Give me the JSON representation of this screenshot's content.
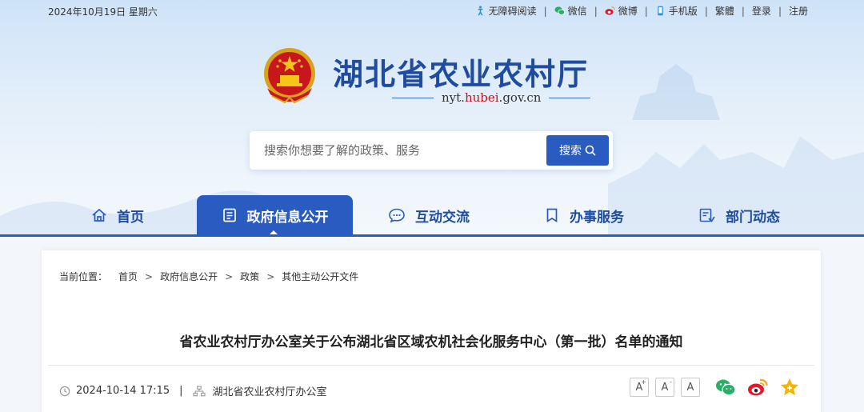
{
  "topbar": {
    "date": "2024年10月19日 星期六",
    "links": [
      {
        "label": "无障碍阅读",
        "icon": "accessibility-icon"
      },
      {
        "label": "微信",
        "icon": "wechat-icon"
      },
      {
        "label": "微博",
        "icon": "weibo-icon"
      },
      {
        "label": "手机版",
        "icon": "mobile-icon"
      },
      {
        "label": "繁體"
      },
      {
        "label": "登录"
      },
      {
        "label": "注册"
      }
    ]
  },
  "brand": {
    "title": "湖北省农业农村厅",
    "url_pre": "nyt.",
    "url_mid": "hubei",
    "url_post": ".gov.cn"
  },
  "search": {
    "placeholder": "搜索你想要了解的政策、服务",
    "button_label": "搜索"
  },
  "nav": {
    "items": [
      {
        "label": "首页",
        "icon": "home-icon"
      },
      {
        "label": "政府信息公开",
        "icon": "document-list-icon",
        "active": true
      },
      {
        "label": "互动交流",
        "icon": "chat-icon"
      },
      {
        "label": "办事服务",
        "icon": "bookmark-icon"
      },
      {
        "label": "部门动态",
        "icon": "news-icon"
      }
    ]
  },
  "breadcrumb": {
    "label": "当前位置：",
    "items": [
      "首页",
      "政府信息公开",
      "政策",
      "其他主动公开文件"
    ],
    "separator": ">"
  },
  "article": {
    "title": "省农业农村厅办公室关于公布湖北省区域农机社会化服务中心（第一批）名单的通知",
    "datetime": "2024-10-14 17:15",
    "separator": "|",
    "source": "湖北省农业农村厅办公室"
  },
  "font_size_controls": [
    "A",
    "A",
    "A"
  ],
  "font_size_marks": [
    "+",
    "-"
  ],
  "share_icons": [
    "wechat-share-icon",
    "weibo-share-icon",
    "favorite-star-icon"
  ],
  "colors": {
    "primary": "#2a5bc1",
    "title_blue": "#1f4c9e",
    "url_red": "#c0121d",
    "wechat_green": "#2aae67",
    "weibo_orange": "#e6162d",
    "star_gold": "#f5b400"
  }
}
